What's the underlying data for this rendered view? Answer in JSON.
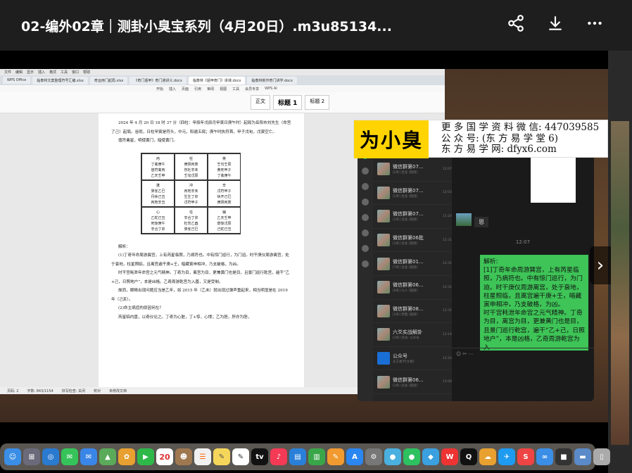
{
  "header": {
    "title": "02-编外02章｜测卦小臭宝系列（4月20日）.m3u85134...",
    "icons": [
      "share-icon",
      "download-icon",
      "more-icon"
    ]
  },
  "wps": {
    "menu": [
      "文件",
      "编辑",
      "显示",
      "插入",
      "格式",
      "工具",
      "窗口",
      "帮助"
    ],
    "tabs": [
      {
        "label": "WPS Office",
        "active": false
      },
      {
        "label": "临泰林文案整理符号汇编.xlsx",
        "active": false
      },
      {
        "label": "奇运用门起局.xlsx",
        "active": false
      },
      {
        "label": "《奇门遁甲》奇门通讲义.docx",
        "active": false
      },
      {
        "label": "临泰林《遁甲奇门》讲课.docx",
        "active": true
      },
      {
        "label": "临泰林新作奇门讲学.docx",
        "active": false
      }
    ],
    "ribbon_tabs": [
      "开始",
      "插入",
      "页面",
      "引用",
      "审阅",
      "视图",
      "工具",
      "会员专享",
      "WPS AI"
    ],
    "styles": [
      "正文",
      "标题 1",
      "标题 2"
    ],
    "doc": {
      "para1": "2024 年 4 月 20 日 18 时 37 分（四柱：甲辰年戊辰月甲寅日庚午时）起局为岳阳市刘先生（命宫了己）起局。谷雨，日柱甲寅是符头，中元，阳遁五局；庚午时执符首，甲子戊旬，戊寅空亡。",
      "para2": "值符禽星，明使黄门，暗使黄门。",
      "grid": [
        "丙\n丁禽庚午\n值符禽丙\n乙天壬申",
        "柱\n庚阴丙寅\n伤杜辛未\n壬勾戊辰",
        "英\n壬句壬辰\n黄死甲子\n丁禽庚午",
        "蓬\n癸雀乙巳\n丹休己丑\n丙地辛丑",
        "冲\n丙地辛未\n生生丁卯\n戊符甲子",
        "辛\n戊符甲子\n休开己巳\n庚阴丙寅",
        "心\n乙蛇己丑\n死惊庚午\n辛合丁卯",
        "任\n辛合丁卯\n杜伤乙酉\n癸雀己巳",
        "辅\n乙天壬申\n景惊戊辰\n己蛇己丑"
      ],
      "analysis_title": "解析：",
      "para3": "(1)丁奇年命周游巽宫，上有芮星临照，乃病符也。中有惊门巡行，为门迫。时干庚仪周游离宫，处于衰地，柱星照临，且离宫遍干庚+壬，暗藏寅申相冲，乃支破格，为凶。",
      "para4": "时干宫耗泄年命宫之元气精神。丁奇为目，离宫为目，更兼黄门也是目，且景门巡行乾宫，遍干“乙+己，日照地户”，本是凶格。乙奇周游乾宫为入墓，又是受制。",
      "para5": "故而，眼睛出现问题应当是乙年，如 2015 年（乙未）就出现过弹声重起来，相当明显是在 2019 年（己亥）。",
      "para6": "(2)命主病症的原因何在？",
      "para7": "芮星临内盘，以奇仪论之。丁奇为心脏，丁+惊，心悸；乙为胆，肝亦为胆，",
      "status": [
        "页码: 2",
        "字数: 843/1154",
        "拼写检查: 关闭",
        "校对",
        "未修改文档"
      ]
    }
  },
  "wechat": {
    "chats": [
      {
        "name": "微信群第07...",
        "preview": "[2条] 吕总 [链接]",
        "time": "12:07"
      },
      {
        "name": "微信群第07...",
        "preview": "[2条] 吕总 [链接]",
        "time": "12:03"
      },
      {
        "name": "微信群第07...",
        "preview": "[2条] 吕总 [链接]",
        "time": "11:20"
      },
      {
        "name": "微信群第06批",
        "preview": "[2条] 吕总 [链接]",
        "time": "12:31"
      },
      {
        "name": "微信群第01...",
        "preview": "[7条] 吕总 [链接]",
        "time": "12:31"
      },
      {
        "name": "微信群第06...",
        "preview": "[6条] 九人 [链接]",
        "time": "12:31"
      },
      {
        "name": "微信群第08...",
        "preview": "[2条] 梦圆 [链接]",
        "time": "12:31"
      },
      {
        "name": "六爻实战解卦",
        "preview": "[2条] 吕总: 公众号",
        "time": "12:14"
      },
      {
        "name": "公众号",
        "preview": "东方易学[文章]",
        "time": "12:10"
      },
      {
        "name": "微信群第06...",
        "preview": "[2条] 吕总 [链接]",
        "time": "12:08"
      }
    ],
    "received_text": "恩",
    "time": "12:07",
    "bubble": "解析:\n[1]丁奇年命周游巽宫，上有芮星临照，乃病符也。中有惊门巡行，为门迫。时干庚仪周游离宫，处于衰地，柱星照临，且离宫遍干庚+壬，暗藏寅申相冲，乃支破格，为凶。\n时干宫耗泄年命宫之元气精神。丁奇为目，离宫为目，更兼黄门也是目，且景门巡行乾宫，遍干“乙+己，日照地户”，本是凶格，乙奇周游乾宫为入"
  },
  "banner": {
    "logo": "为小臭",
    "line1": "更 多 国 学 资 料 微 信: 447039585",
    "line2": "公 众 号: (东 方 易 学 堂 6)",
    "line3": "东 方 易 学 网: dfyx6.com"
  },
  "dock": {
    "calendar_day": "20",
    "app_icons": [
      "finder-icon",
      "launchpad-icon",
      "safari-icon",
      "messages-icon",
      "mail-icon",
      "maps-icon",
      "photos-icon",
      "facetime-icon",
      "calendar-icon",
      "contacts-icon",
      "reminders-icon",
      "notes-icon",
      "tv-icon",
      "music-icon",
      "keynote-icon",
      "numbers-icon",
      "pages-icon",
      "appstore-icon",
      "settings-icon",
      "wechat-icon",
      "qq-icon",
      "trash-icon"
    ]
  },
  "colors": {
    "topbar": "#1e1e1e",
    "bubble": "#3ec457",
    "banner_logo": "#ffd400"
  }
}
